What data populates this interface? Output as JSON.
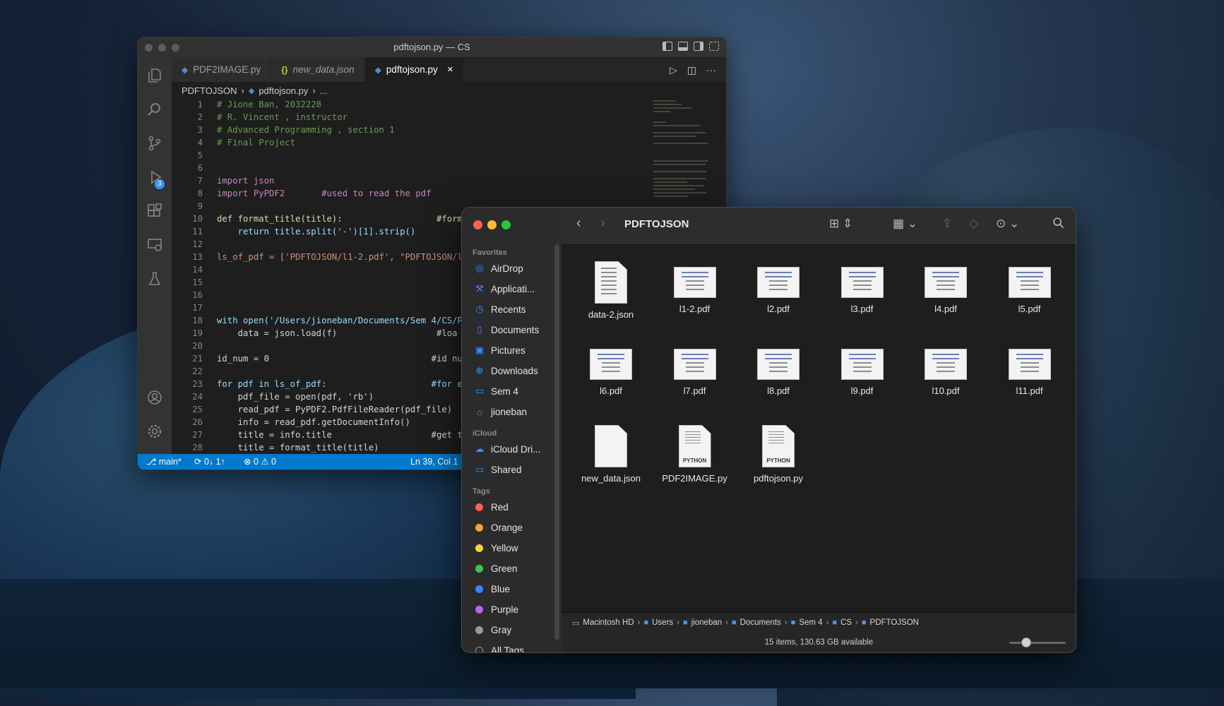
{
  "vscode": {
    "window_title": "pdftojson.py — CS",
    "tabs": [
      {
        "label": "PDF2IMAGE.py",
        "type": "py",
        "active": false
      },
      {
        "label": "new_data.json",
        "type": "json",
        "active": false
      },
      {
        "label": "pdftojson.py",
        "type": "py",
        "active": true
      }
    ],
    "tab_close": "✕",
    "breadcrumb": {
      "folder": "PDFTOJSON",
      "file": "pdftojson.py",
      "more": "..."
    },
    "scm_badge": "3",
    "code_lines": [
      {
        "n": "1",
        "text": "# Jione Ban, 2032228"
      },
      {
        "n": "2",
        "text": "# R. Vincent , instructor"
      },
      {
        "n": "3",
        "text": "# Advanced Programming , section 1"
      },
      {
        "n": "4",
        "text": "# Final Project"
      },
      {
        "n": "5",
        "text": ""
      },
      {
        "n": "6",
        "text": ""
      },
      {
        "n": "7",
        "text": "import json"
      },
      {
        "n": "8",
        "text": "import PyPDF2       #used to read the pdf"
      },
      {
        "n": "9",
        "text": ""
      },
      {
        "n": "10",
        "text": "def format_title(title):                  #form"
      },
      {
        "n": "11",
        "text": "    return title.split('-')[1].strip()"
      },
      {
        "n": "12",
        "text": ""
      },
      {
        "n": "13",
        "text": "ls_of_pdf = ['PDFTOJSON/l1-2.pdf', \"PDFTOJSON/l2"
      },
      {
        "n": "14",
        "text": ""
      },
      {
        "n": "15",
        "text": ""
      },
      {
        "n": "16",
        "text": ""
      },
      {
        "n": "17",
        "text": ""
      },
      {
        "n": "18",
        "text": "with open('/Users/jioneban/Documents/Sem 4/CS/PD"
      },
      {
        "n": "19",
        "text": "    data = json.load(f)                   #loa"
      },
      {
        "n": "20",
        "text": ""
      },
      {
        "n": "21",
        "text": "id_num = 0                               #id nu"
      },
      {
        "n": "22",
        "text": ""
      },
      {
        "n": "23",
        "text": "for pdf in ls_of_pdf:                    #for e"
      },
      {
        "n": "24",
        "text": "    pdf_file = open(pdf, 'rb')"
      },
      {
        "n": "25",
        "text": "    read_pdf = PyPDF2.PdfFileReader(pdf_file)"
      },
      {
        "n": "26",
        "text": "    info = read_pdf.getDocumentInfo()"
      },
      {
        "n": "27",
        "text": "    title = info.title                   #get t"
      },
      {
        "n": "28",
        "text": "    title = format_title(title)"
      }
    ],
    "status": {
      "branch": "main*",
      "sync": "0↓ 1↑",
      "problems": "⊗ 0 ⚠ 0",
      "position": "Ln 39, Col 1"
    },
    "colors": {
      "statusbar": "#007acc",
      "editor_bg": "#1e1e1e"
    }
  },
  "finder": {
    "title": "PDFTOJSON",
    "sidebar": {
      "favorites_label": "Favorites",
      "favorites": [
        {
          "label": "AirDrop",
          "icon": "airdrop-icon"
        },
        {
          "label": "Applicati...",
          "icon": "applications-icon"
        },
        {
          "label": "Recents",
          "icon": "clock-icon"
        },
        {
          "label": "Documents",
          "icon": "document-icon"
        },
        {
          "label": "Pictures",
          "icon": "pictures-icon"
        },
        {
          "label": "Downloads",
          "icon": "download-icon"
        },
        {
          "label": "Sem 4",
          "icon": "folder-icon"
        },
        {
          "label": "jioneban",
          "icon": "home-icon"
        }
      ],
      "icloud_label": "iCloud",
      "icloud": [
        {
          "label": "iCloud Dri...",
          "icon": "cloud-icon"
        },
        {
          "label": "Shared",
          "icon": "shared-folder-icon"
        }
      ],
      "tags_label": "Tags",
      "tags": [
        {
          "label": "Red",
          "color": "#ff5f57"
        },
        {
          "label": "Orange",
          "color": "#f4a338"
        },
        {
          "label": "Yellow",
          "color": "#f7d33b"
        },
        {
          "label": "Green",
          "color": "#3ec54e"
        },
        {
          "label": "Blue",
          "color": "#3b82f6"
        },
        {
          "label": "Purple",
          "color": "#b567e0"
        },
        {
          "label": "Gray",
          "color": "#9a9a9a"
        },
        {
          "label": "All Tags...",
          "color": ""
        }
      ]
    },
    "files": [
      {
        "name": "data-2.json",
        "kind": "doc"
      },
      {
        "name": "l1-2.pdf",
        "kind": "pdf"
      },
      {
        "name": "l2.pdf",
        "kind": "pdf"
      },
      {
        "name": "l3.pdf",
        "kind": "pdf"
      },
      {
        "name": "l4.pdf",
        "kind": "pdf"
      },
      {
        "name": "l5.pdf",
        "kind": "pdf"
      },
      {
        "name": "l6.pdf",
        "kind": "pdf"
      },
      {
        "name": "l7.pdf",
        "kind": "pdf"
      },
      {
        "name": "l8.pdf",
        "kind": "pdf"
      },
      {
        "name": "l9.pdf",
        "kind": "pdf"
      },
      {
        "name": "l10.pdf",
        "kind": "pdf"
      },
      {
        "name": "l11.pdf",
        "kind": "pdf"
      },
      {
        "name": "new_data.json",
        "kind": "doc"
      },
      {
        "name": "PDF2IMAGE.py",
        "kind": "py",
        "badge": "PYTHON"
      },
      {
        "name": "pdftojson.py",
        "kind": "py",
        "badge": "PYTHON"
      }
    ],
    "path": [
      "Macintosh HD",
      "Users",
      "jioneban",
      "Documents",
      "Sem 4",
      "CS",
      "PDFTOJSON"
    ],
    "status_text": "15 items, 130.63 GB available",
    "icon_size_fraction": 0.3
  }
}
